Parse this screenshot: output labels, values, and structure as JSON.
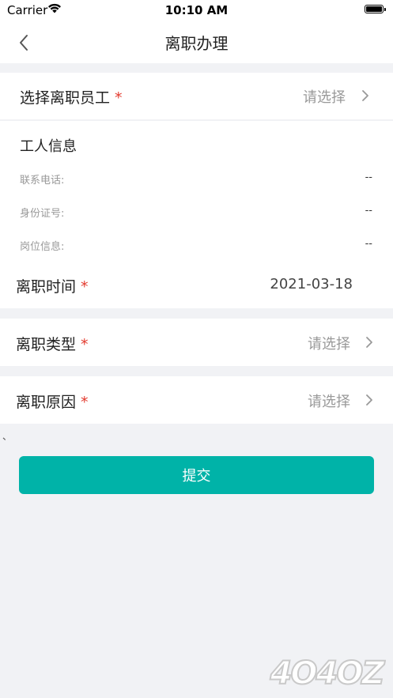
{
  "status_bar": {
    "carrier": "Carrier",
    "time": "10:10 AM"
  },
  "nav": {
    "title": "离职办理"
  },
  "employee_select": {
    "label": "选择离职员工",
    "required_mark": "*",
    "placeholder": "请选择"
  },
  "worker_info": {
    "title": "工人信息",
    "fields": [
      {
        "label": "联系电话:",
        "value": "--"
      },
      {
        "label": "身份证号:",
        "value": "--"
      },
      {
        "label": "岗位信息:",
        "value": "--"
      }
    ]
  },
  "leave_date": {
    "label": "离职时间",
    "required_mark": "*",
    "value": "2021-03-18"
  },
  "leave_type": {
    "label": "离职类型",
    "required_mark": "*",
    "placeholder": "请选择"
  },
  "leave_reason": {
    "label": "离职原因",
    "required_mark": "*",
    "placeholder": "请选择"
  },
  "stray_mark": "、",
  "submit": {
    "label": "提交"
  },
  "colors": {
    "accent": "#00b3a8",
    "required": "#e33b2f",
    "background": "#f1f2f5"
  },
  "watermark": {
    "text": "4O4OZ"
  }
}
